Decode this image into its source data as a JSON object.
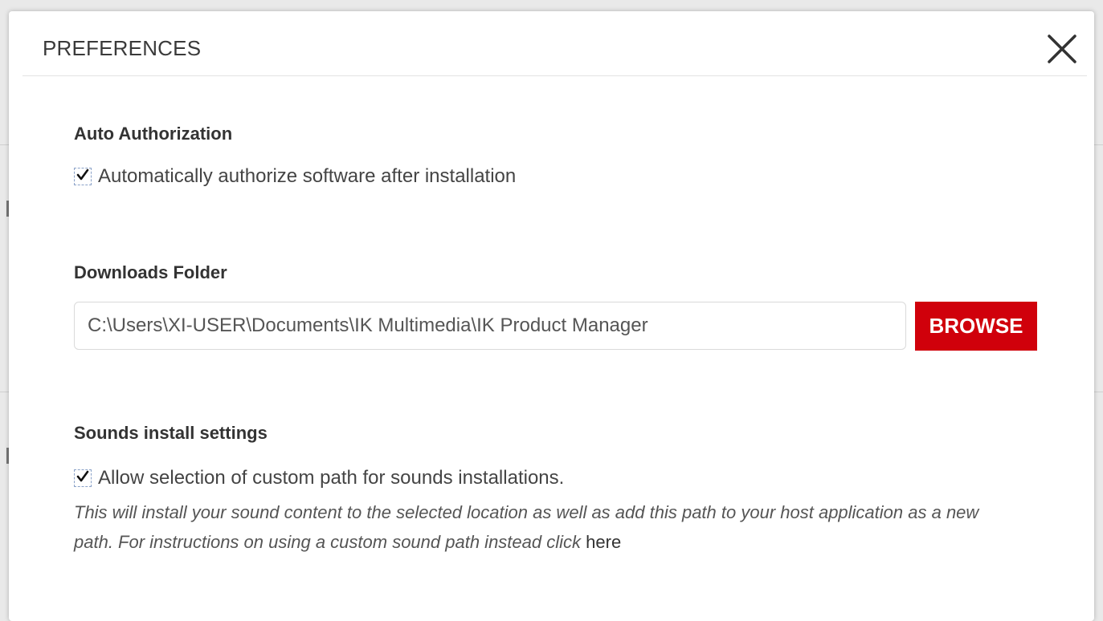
{
  "dialog": {
    "title": "PREFERENCES",
    "close_icon": "close-icon"
  },
  "auto_authorization": {
    "heading": "Auto Authorization",
    "checkbox_label": "Automatically authorize software after installation",
    "checked": true
  },
  "downloads_folder": {
    "heading": "Downloads Folder",
    "path_value": "C:\\Users\\XI-USER\\Documents\\IK Multimedia\\IK Product Manager",
    "browse_label": "BROWSE"
  },
  "sounds_install": {
    "heading": "Sounds install settings",
    "checkbox_label": "Allow selection of custom path for sounds installations.",
    "checked": true,
    "help_text": "This will install your sound content to the selected location as well as add this path to your host application as a new path. For instructions on using a custom sound path instead click",
    "help_link": "here"
  },
  "colors": {
    "accent": "#d0000b",
    "heading": "#333333",
    "text": "#444444"
  }
}
